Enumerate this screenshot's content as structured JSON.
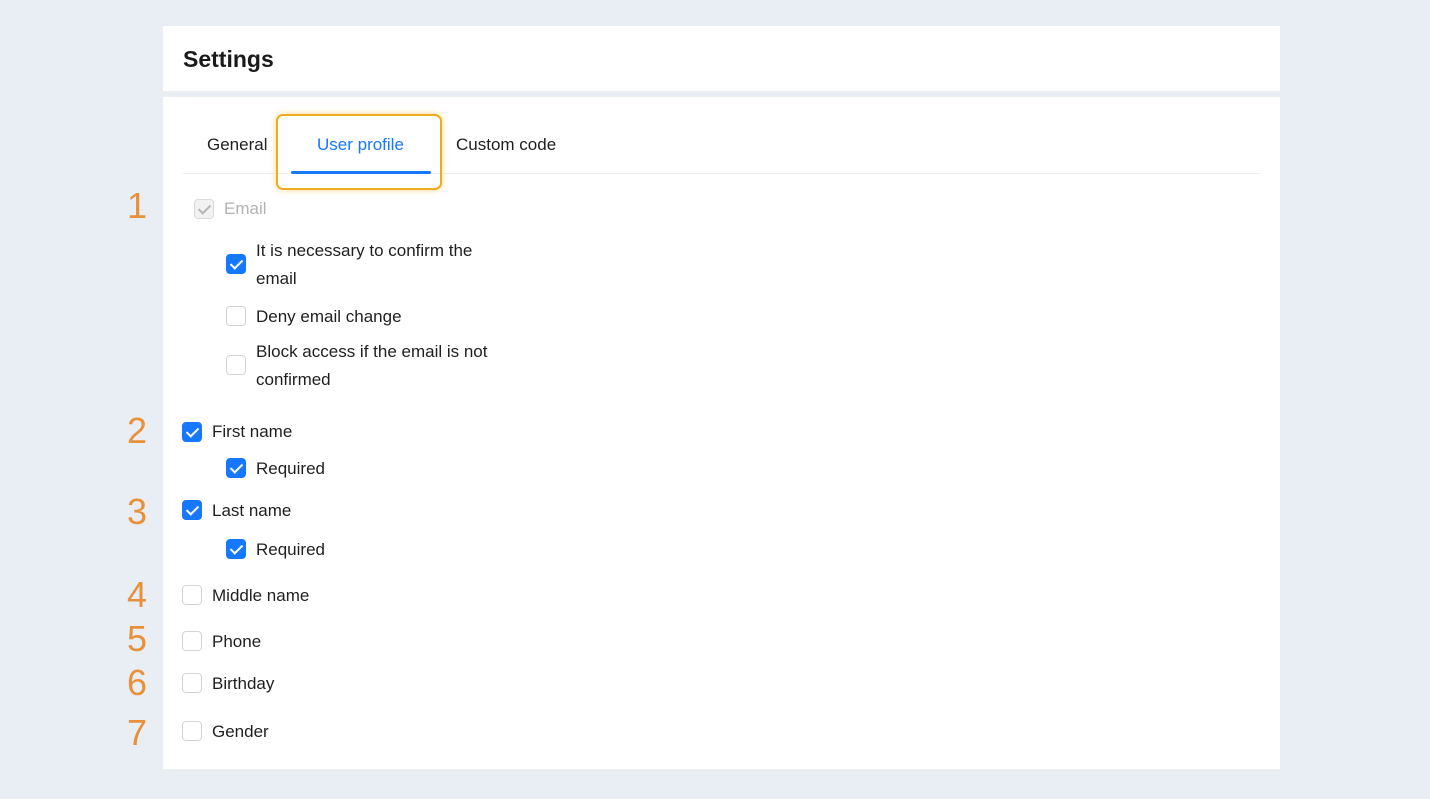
{
  "header": {
    "title": "Settings"
  },
  "tabs": [
    {
      "label": "General",
      "active": false
    },
    {
      "label": "User profile",
      "active": true
    },
    {
      "label": "Custom code",
      "active": false
    }
  ],
  "markers": [
    "1",
    "2",
    "3",
    "4",
    "5",
    "6",
    "7"
  ],
  "fields": {
    "email": {
      "label": "Email",
      "checked": true,
      "disabled": true,
      "options": [
        {
          "label": "It is necessary to confirm the email",
          "checked": true
        },
        {
          "label": "Deny email change",
          "checked": false
        },
        {
          "label": "Block access if the email is not confirmed",
          "checked": false
        }
      ]
    },
    "first_name": {
      "label": "First name",
      "checked": true,
      "required_label": "Required",
      "required_checked": true
    },
    "last_name": {
      "label": "Last name",
      "checked": true,
      "required_label": "Required",
      "required_checked": true
    },
    "middle_name": {
      "label": "Middle name",
      "checked": false
    },
    "phone": {
      "label": "Phone",
      "checked": false
    },
    "birthday": {
      "label": "Birthday",
      "checked": false
    },
    "gender": {
      "label": "Gender",
      "checked": false
    }
  },
  "colors": {
    "primary": "#1677ff",
    "highlight": "#f0ab1b",
    "marker": "#e8913a",
    "background": "#e9eef5"
  }
}
